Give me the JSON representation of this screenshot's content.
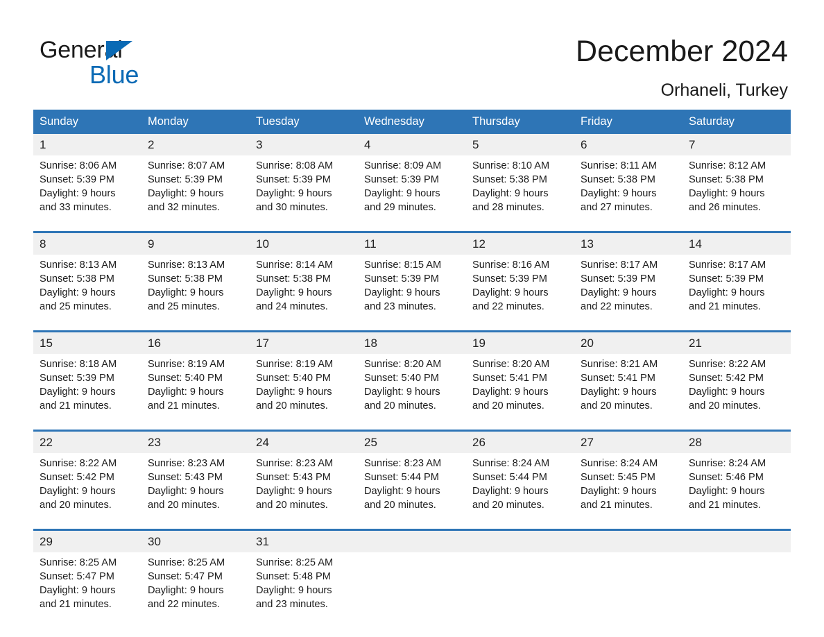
{
  "brand": {
    "word_general": "General",
    "word_blue": "Blue",
    "triangle_color": "#0a6ab5"
  },
  "header": {
    "month_title": "December 2024",
    "location": "Orhaneli, Turkey"
  },
  "colors": {
    "header_blue": "#2e75b6",
    "daynum_band": "#f0f0f0",
    "separator_blue": "#2e75b6",
    "text": "#1c1c1c"
  },
  "calendar": {
    "weekday_headers": [
      "Sunday",
      "Monday",
      "Tuesday",
      "Wednesday",
      "Thursday",
      "Friday",
      "Saturday"
    ],
    "weeks": [
      {
        "days": [
          {
            "num": "1",
            "sunrise": "Sunrise: 8:06 AM",
            "sunset": "Sunset: 5:39 PM",
            "daylight_1": "Daylight: 9 hours",
            "daylight_2": "and 33 minutes."
          },
          {
            "num": "2",
            "sunrise": "Sunrise: 8:07 AM",
            "sunset": "Sunset: 5:39 PM",
            "daylight_1": "Daylight: 9 hours",
            "daylight_2": "and 32 minutes."
          },
          {
            "num": "3",
            "sunrise": "Sunrise: 8:08 AM",
            "sunset": "Sunset: 5:39 PM",
            "daylight_1": "Daylight: 9 hours",
            "daylight_2": "and 30 minutes."
          },
          {
            "num": "4",
            "sunrise": "Sunrise: 8:09 AM",
            "sunset": "Sunset: 5:39 PM",
            "daylight_1": "Daylight: 9 hours",
            "daylight_2": "and 29 minutes."
          },
          {
            "num": "5",
            "sunrise": "Sunrise: 8:10 AM",
            "sunset": "Sunset: 5:38 PM",
            "daylight_1": "Daylight: 9 hours",
            "daylight_2": "and 28 minutes."
          },
          {
            "num": "6",
            "sunrise": "Sunrise: 8:11 AM",
            "sunset": "Sunset: 5:38 PM",
            "daylight_1": "Daylight: 9 hours",
            "daylight_2": "and 27 minutes."
          },
          {
            "num": "7",
            "sunrise": "Sunrise: 8:12 AM",
            "sunset": "Sunset: 5:38 PM",
            "daylight_1": "Daylight: 9 hours",
            "daylight_2": "and 26 minutes."
          }
        ]
      },
      {
        "days": [
          {
            "num": "8",
            "sunrise": "Sunrise: 8:13 AM",
            "sunset": "Sunset: 5:38 PM",
            "daylight_1": "Daylight: 9 hours",
            "daylight_2": "and 25 minutes."
          },
          {
            "num": "9",
            "sunrise": "Sunrise: 8:13 AM",
            "sunset": "Sunset: 5:38 PM",
            "daylight_1": "Daylight: 9 hours",
            "daylight_2": "and 25 minutes."
          },
          {
            "num": "10",
            "sunrise": "Sunrise: 8:14 AM",
            "sunset": "Sunset: 5:38 PM",
            "daylight_1": "Daylight: 9 hours",
            "daylight_2": "and 24 minutes."
          },
          {
            "num": "11",
            "sunrise": "Sunrise: 8:15 AM",
            "sunset": "Sunset: 5:39 PM",
            "daylight_1": "Daylight: 9 hours",
            "daylight_2": "and 23 minutes."
          },
          {
            "num": "12",
            "sunrise": "Sunrise: 8:16 AM",
            "sunset": "Sunset: 5:39 PM",
            "daylight_1": "Daylight: 9 hours",
            "daylight_2": "and 22 minutes."
          },
          {
            "num": "13",
            "sunrise": "Sunrise: 8:17 AM",
            "sunset": "Sunset: 5:39 PM",
            "daylight_1": "Daylight: 9 hours",
            "daylight_2": "and 22 minutes."
          },
          {
            "num": "14",
            "sunrise": "Sunrise: 8:17 AM",
            "sunset": "Sunset: 5:39 PM",
            "daylight_1": "Daylight: 9 hours",
            "daylight_2": "and 21 minutes."
          }
        ]
      },
      {
        "days": [
          {
            "num": "15",
            "sunrise": "Sunrise: 8:18 AM",
            "sunset": "Sunset: 5:39 PM",
            "daylight_1": "Daylight: 9 hours",
            "daylight_2": "and 21 minutes."
          },
          {
            "num": "16",
            "sunrise": "Sunrise: 8:19 AM",
            "sunset": "Sunset: 5:40 PM",
            "daylight_1": "Daylight: 9 hours",
            "daylight_2": "and 21 minutes."
          },
          {
            "num": "17",
            "sunrise": "Sunrise: 8:19 AM",
            "sunset": "Sunset: 5:40 PM",
            "daylight_1": "Daylight: 9 hours",
            "daylight_2": "and 20 minutes."
          },
          {
            "num": "18",
            "sunrise": "Sunrise: 8:20 AM",
            "sunset": "Sunset: 5:40 PM",
            "daylight_1": "Daylight: 9 hours",
            "daylight_2": "and 20 minutes."
          },
          {
            "num": "19",
            "sunrise": "Sunrise: 8:20 AM",
            "sunset": "Sunset: 5:41 PM",
            "daylight_1": "Daylight: 9 hours",
            "daylight_2": "and 20 minutes."
          },
          {
            "num": "20",
            "sunrise": "Sunrise: 8:21 AM",
            "sunset": "Sunset: 5:41 PM",
            "daylight_1": "Daylight: 9 hours",
            "daylight_2": "and 20 minutes."
          },
          {
            "num": "21",
            "sunrise": "Sunrise: 8:22 AM",
            "sunset": "Sunset: 5:42 PM",
            "daylight_1": "Daylight: 9 hours",
            "daylight_2": "and 20 minutes."
          }
        ]
      },
      {
        "days": [
          {
            "num": "22",
            "sunrise": "Sunrise: 8:22 AM",
            "sunset": "Sunset: 5:42 PM",
            "daylight_1": "Daylight: 9 hours",
            "daylight_2": "and 20 minutes."
          },
          {
            "num": "23",
            "sunrise": "Sunrise: 8:23 AM",
            "sunset": "Sunset: 5:43 PM",
            "daylight_1": "Daylight: 9 hours",
            "daylight_2": "and 20 minutes."
          },
          {
            "num": "24",
            "sunrise": "Sunrise: 8:23 AM",
            "sunset": "Sunset: 5:43 PM",
            "daylight_1": "Daylight: 9 hours",
            "daylight_2": "and 20 minutes."
          },
          {
            "num": "25",
            "sunrise": "Sunrise: 8:23 AM",
            "sunset": "Sunset: 5:44 PM",
            "daylight_1": "Daylight: 9 hours",
            "daylight_2": "and 20 minutes."
          },
          {
            "num": "26",
            "sunrise": "Sunrise: 8:24 AM",
            "sunset": "Sunset: 5:44 PM",
            "daylight_1": "Daylight: 9 hours",
            "daylight_2": "and 20 minutes."
          },
          {
            "num": "27",
            "sunrise": "Sunrise: 8:24 AM",
            "sunset": "Sunset: 5:45 PM",
            "daylight_1": "Daylight: 9 hours",
            "daylight_2": "and 21 minutes."
          },
          {
            "num": "28",
            "sunrise": "Sunrise: 8:24 AM",
            "sunset": "Sunset: 5:46 PM",
            "daylight_1": "Daylight: 9 hours",
            "daylight_2": "and 21 minutes."
          }
        ]
      },
      {
        "days": [
          {
            "num": "29",
            "sunrise": "Sunrise: 8:25 AM",
            "sunset": "Sunset: 5:47 PM",
            "daylight_1": "Daylight: 9 hours",
            "daylight_2": "and 21 minutes."
          },
          {
            "num": "30",
            "sunrise": "Sunrise: 8:25 AM",
            "sunset": "Sunset: 5:47 PM",
            "daylight_1": "Daylight: 9 hours",
            "daylight_2": "and 22 minutes."
          },
          {
            "num": "31",
            "sunrise": "Sunrise: 8:25 AM",
            "sunset": "Sunset: 5:48 PM",
            "daylight_1": "Daylight: 9 hours",
            "daylight_2": "and 23 minutes."
          },
          {
            "num": "",
            "sunrise": "",
            "sunset": "",
            "daylight_1": "",
            "daylight_2": "",
            "empty": true
          },
          {
            "num": "",
            "sunrise": "",
            "sunset": "",
            "daylight_1": "",
            "daylight_2": "",
            "empty": true
          },
          {
            "num": "",
            "sunrise": "",
            "sunset": "",
            "daylight_1": "",
            "daylight_2": "",
            "empty": true
          },
          {
            "num": "",
            "sunrise": "",
            "sunset": "",
            "daylight_1": "",
            "daylight_2": "",
            "empty": true
          }
        ]
      }
    ]
  }
}
